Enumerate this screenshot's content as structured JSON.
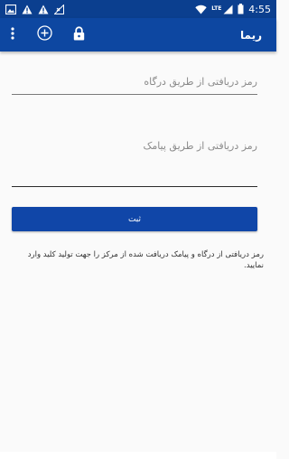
{
  "status_bar": {
    "time": "4:55",
    "network": "LTE",
    "icons": [
      "gallery-icon",
      "warning-icon",
      "warning-icon",
      "signal-off-icon",
      "wifi-icon",
      "cell-signal-icon",
      "battery-icon"
    ]
  },
  "app_bar": {
    "title": "ریما",
    "icons": [
      "more-vert-icon",
      "add-circle-icon",
      "lock-icon"
    ],
    "color": "#0d47a1"
  },
  "form": {
    "gateway_code_placeholder": "رمز دریافتی از طریق درگاه",
    "sms_code_placeholder": "رمز دریافتی از طریق پیامک",
    "submit_label": "ثبت"
  },
  "info": {
    "text": "رمز دریافتی از درگاه و پیامک دریافت شده از مرکز را جهت تولید کلید وارد نمایید."
  }
}
